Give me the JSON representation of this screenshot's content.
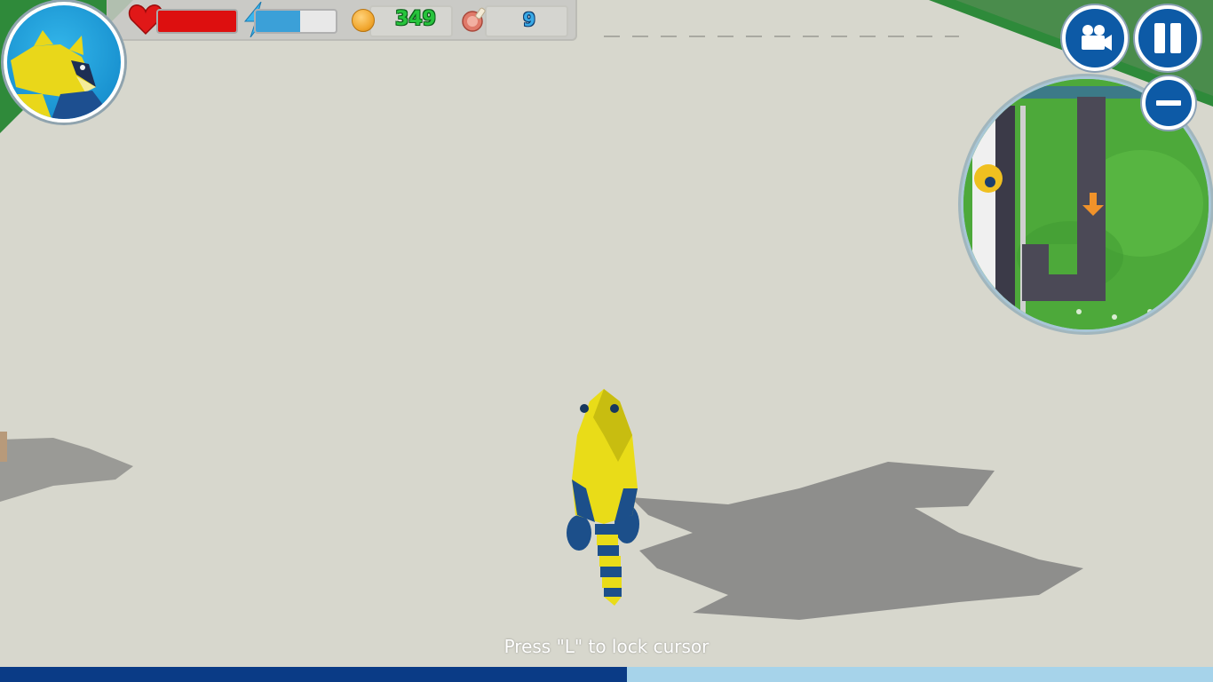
{
  "hud": {
    "health_level": 1.0,
    "energy_level": 0.55,
    "coins": "349",
    "meat": "9"
  },
  "buttons": {
    "camera_icon": "video-camera-icon",
    "pause_icon": "pause-icon",
    "zoom_out_icon": "minus-icon"
  },
  "minimap": {
    "direction_marker_icon": "arrow-down-icon",
    "marker_color": "#f0922a"
  },
  "hint": {
    "text": "Press \"L\" to lock cursor"
  },
  "loading": {
    "progress": 0.517
  },
  "colors": {
    "button_blue": "#0d5aa6",
    "health_red": "#dd0f0f",
    "energy_blue": "#3ba0d8",
    "coin_green": "#27c43c",
    "meat_blue": "#39a9e6",
    "progress_dark": "#0a3b86",
    "progress_light": "#a6d3ea"
  }
}
